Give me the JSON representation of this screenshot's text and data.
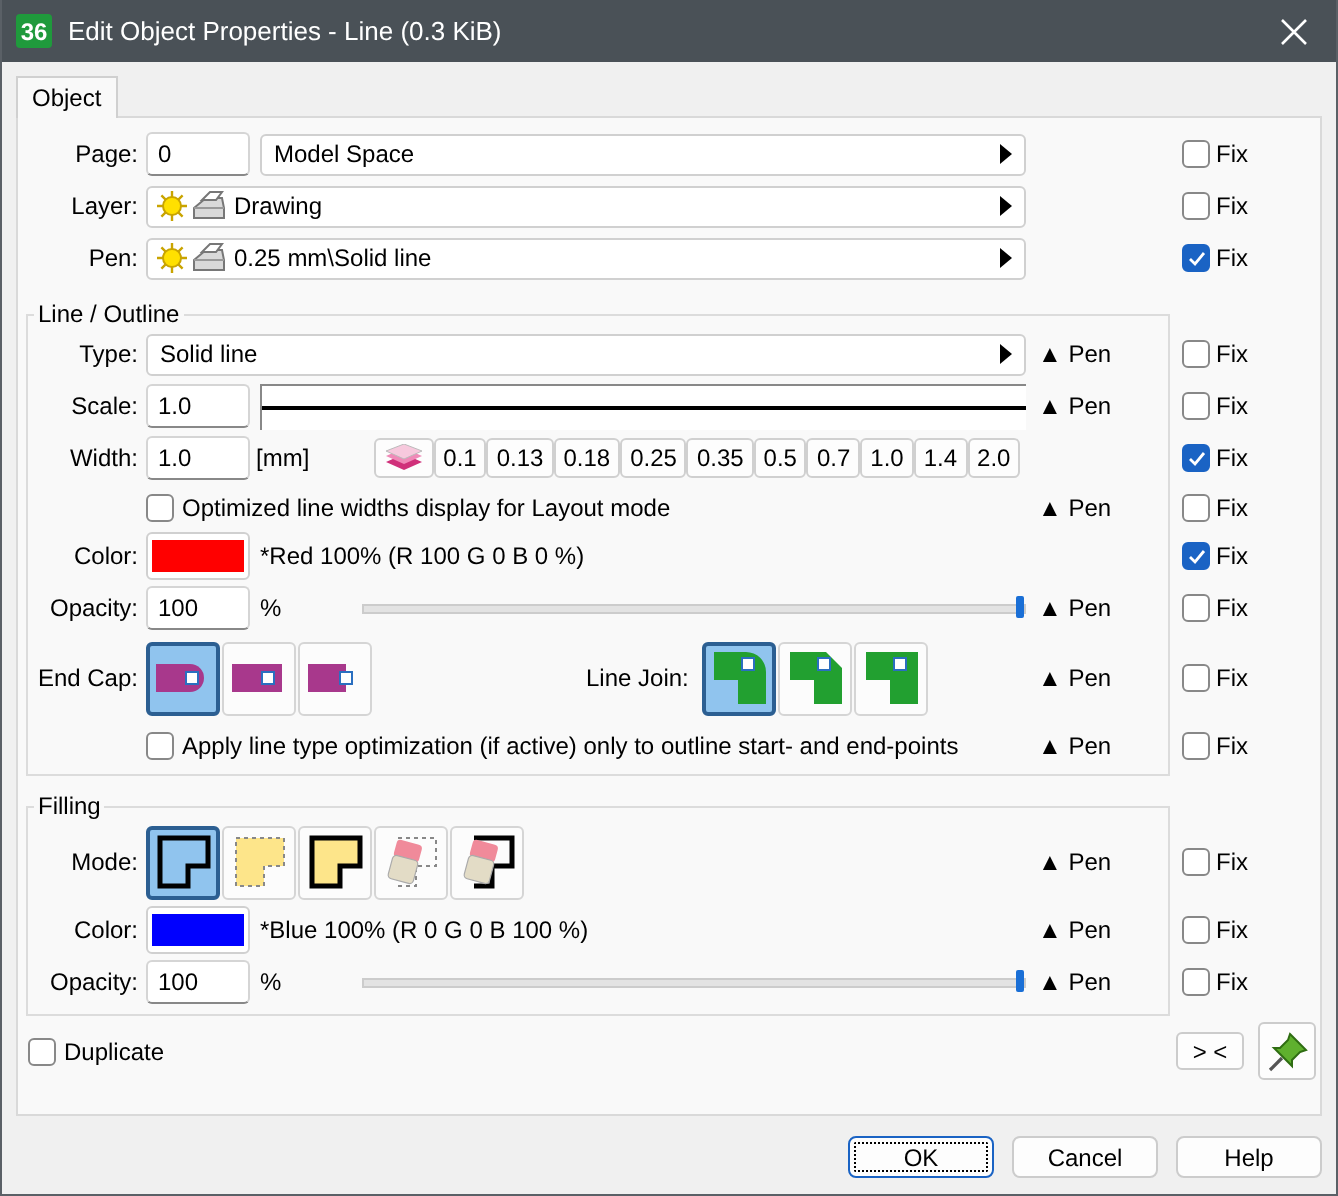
{
  "window": {
    "app_icon": "36",
    "title": "Edit Object Properties - Line (0.3 KiB)"
  },
  "tabs": [
    {
      "label": "Object",
      "selected": true
    }
  ],
  "general": [
    {
      "kind": "field_select",
      "label": "Page:",
      "value": "0",
      "option": "Model Space",
      "fix": {
        "label": "Fix",
        "checked": false
      }
    },
    {
      "kind": "icon_select",
      "label": "Layer:",
      "option": "Drawing",
      "fix": {
        "label": "Fix",
        "checked": false
      }
    },
    {
      "kind": "icon_select",
      "label": "Pen:",
      "option": "0.25 mm\\Solid line",
      "fix": {
        "label": "Fix",
        "checked": true
      }
    }
  ],
  "line_outline": {
    "title": "Line / Outline",
    "rows": [
      {
        "kind": "select",
        "label": "Type:",
        "option": "Solid line",
        "pen": "▲ Pen",
        "fix": {
          "label": "Fix",
          "checked": false
        }
      },
      {
        "kind": "scale",
        "label": "Scale:",
        "value": "1.0",
        "pen": "▲ Pen",
        "fix": {
          "label": "Fix",
          "checked": false
        }
      },
      {
        "kind": "width",
        "label": "Width:",
        "value": "1.0",
        "unit": "[mm]",
        "presets": [
          "0.1",
          "0.13",
          "0.18",
          "0.25",
          "0.35",
          "0.5",
          "0.7",
          "1.0",
          "1.4",
          "2.0"
        ],
        "fix": {
          "label": "Fix",
          "checked": true
        }
      },
      {
        "kind": "checkbox",
        "text": "Optimized line widths display for Layout mode",
        "checked": false,
        "pen": "▲ Pen",
        "fix": {
          "label": "Fix",
          "checked": false
        }
      },
      {
        "kind": "color",
        "label": "Color:",
        "color": "#ff0000",
        "description": "*Red 100% (R 100 G 0 B 0 %)",
        "fix": {
          "label": "Fix",
          "checked": true
        }
      },
      {
        "kind": "opacity",
        "label": "Opacity:",
        "value": "100",
        "unit": "%",
        "level": 1,
        "pen": "▲ Pen",
        "fix": {
          "label": "Fix",
          "checked": false
        }
      },
      {
        "kind": "caps",
        "label": "End Cap:",
        "caps": [
          {
            "kind": "round",
            "selected": true
          },
          {
            "kind": "square",
            "selected": false
          },
          {
            "kind": "flat",
            "selected": false
          }
        ],
        "join_label": "Line Join:",
        "joins": [
          {
            "kind": "round",
            "selected": true
          },
          {
            "kind": "bevel",
            "selected": false
          },
          {
            "kind": "miter",
            "selected": false
          }
        ],
        "pen": "▲ Pen",
        "fix": {
          "label": "Fix",
          "checked": false
        }
      },
      {
        "kind": "checkbox",
        "text": "Apply line type optimization (if active) only to outline start- and end-points",
        "checked": false,
        "pen": "▲ Pen",
        "fix": {
          "label": "Fix",
          "checked": false
        }
      }
    ]
  },
  "filling": {
    "title": "Filling",
    "rows": [
      {
        "kind": "modes",
        "label": "Mode:",
        "modes": [
          {
            "kind": "outline",
            "selected": true
          },
          {
            "kind": "fill",
            "selected": false
          },
          {
            "kind": "fill_outline",
            "selected": false
          },
          {
            "kind": "erase",
            "selected": false
          },
          {
            "kind": "erase_outline",
            "selected": false
          }
        ],
        "pen": "▲ Pen",
        "fix": {
          "label": "Fix",
          "checked": false
        }
      },
      {
        "kind": "color",
        "label": "Color:",
        "color": "#0000ff",
        "description": "*Blue 100% (R 0 G 0 B 100 %)",
        "pen": "▲ Pen",
        "fix": {
          "label": "Fix",
          "checked": false
        }
      },
      {
        "kind": "opacity",
        "label": "Opacity:",
        "value": "100",
        "unit": "%",
        "level": 1,
        "pen": "▲ Pen",
        "fix": {
          "label": "Fix",
          "checked": false
        }
      }
    ]
  },
  "duplicate": {
    "label": "Duplicate",
    "checked": false
  },
  "swap_button": "> <",
  "buttons": [
    {
      "label": "OK",
      "default": true
    },
    {
      "label": "Cancel",
      "default": false
    },
    {
      "label": "Help",
      "default": false
    }
  ]
}
